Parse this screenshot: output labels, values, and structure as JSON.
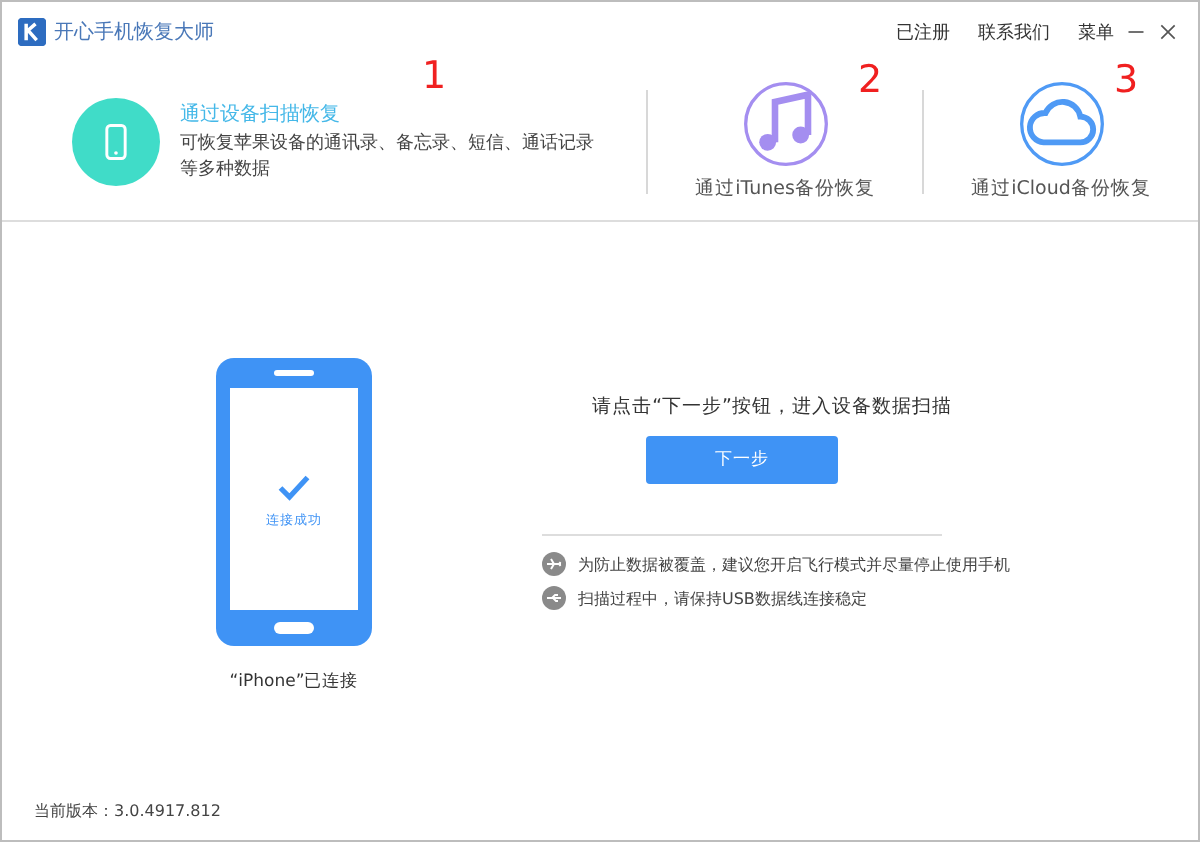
{
  "window": {
    "title": "开心手机恢复大师",
    "menu": [
      "已注册",
      "联系我们",
      "菜单"
    ]
  },
  "modes": [
    {
      "kind": "device",
      "title": "通过设备扫描恢复",
      "description": "可恢复苹果设备的通讯录、备忘录、短信、通话记录等多种数据",
      "selected": true
    },
    {
      "kind": "itunes",
      "title": "通过iTunes备份恢复",
      "selected": false
    },
    {
      "kind": "icloud",
      "title": "通过iCloud备份恢复",
      "selected": false
    }
  ],
  "annotations": [
    "1",
    "2",
    "3"
  ],
  "device": {
    "status": "连接成功",
    "caption": "“iPhone”已连接"
  },
  "instruction": "请点击“下一步”按钮，进入设备数据扫描",
  "next_button": "下一步",
  "tips": [
    {
      "kind": "airplane",
      "text": "为防止数据被覆盖，建议您开启飞行模式并尽量停止使用手机"
    },
    {
      "kind": "usb",
      "text": "扫描过程中，请保持USB数据线连接稳定"
    }
  ],
  "status_bar": "当前版本：3.0.4917.812"
}
